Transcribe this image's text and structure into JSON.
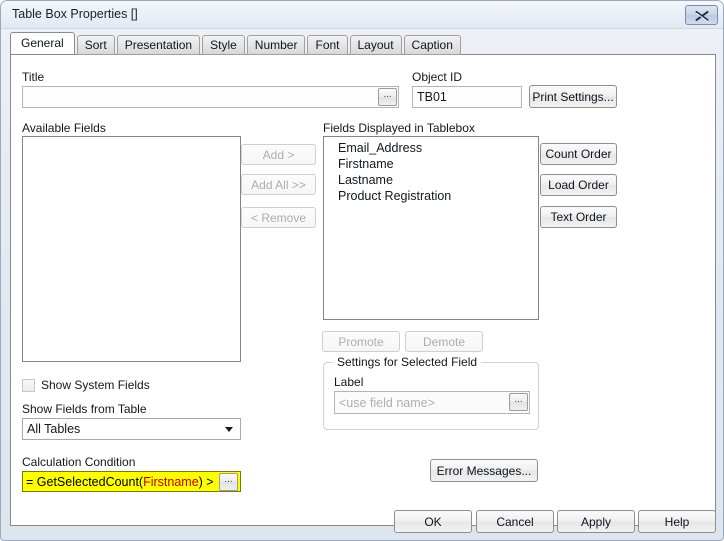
{
  "window": {
    "title": "Table Box Properties []",
    "close_icon": "close-icon"
  },
  "tabs": [
    {
      "label": "General",
      "active": true
    },
    {
      "label": "Sort",
      "active": false
    },
    {
      "label": "Presentation",
      "active": false
    },
    {
      "label": "Style",
      "active": false
    },
    {
      "label": "Number",
      "active": false
    },
    {
      "label": "Font",
      "active": false
    },
    {
      "label": "Layout",
      "active": false
    },
    {
      "label": "Caption",
      "active": false
    }
  ],
  "general": {
    "title_label": "Title",
    "title_value": "",
    "title_ellipsis": "...",
    "object_id_label": "Object ID",
    "object_id_value": "TB01",
    "print_settings_button": "Print Settings...",
    "available_fields_label": "Available Fields",
    "available_fields": [],
    "transfer_buttons": [
      {
        "label": "Add >",
        "enabled": false
      },
      {
        "label": "Add All >>",
        "enabled": false
      },
      {
        "label": "< Remove",
        "enabled": false
      }
    ],
    "displayed_fields_label": "Fields Displayed in Tablebox",
    "displayed_fields": [
      "Email_Address",
      "Firstname",
      "Lastname",
      "Product Registration"
    ],
    "order_buttons": [
      {
        "label": "Count Order",
        "enabled": true
      },
      {
        "label": "Load Order",
        "enabled": true
      },
      {
        "label": "Text Order",
        "enabled": true
      }
    ],
    "promote_button": {
      "label": "Promote",
      "enabled": false
    },
    "demote_button": {
      "label": "Demote",
      "enabled": false
    },
    "settings_group_title": "Settings for Selected Field",
    "label_field_label": "Label",
    "label_field_placeholder": "<use field name>",
    "label_field_value": "",
    "label_field_ellipsis": "...",
    "show_system_fields": {
      "label": "Show System Fields",
      "checked": false
    },
    "show_fields_from_table_label": "Show Fields from Table",
    "show_fields_from_table_value": "All Tables",
    "show_fields_from_table_options": [
      "All Tables"
    ],
    "calculation_condition_label": "Calculation Condition",
    "calculation_condition_expression_prefix": "= GetSelectedCount(",
    "calculation_condition_expression_field": "Firstname",
    "calculation_condition_expression_suffix": ") >",
    "calculation_condition_ellipsis": "...",
    "error_messages_button": "Error Messages..."
  },
  "footer": {
    "ok_button": "OK",
    "cancel_button": "Cancel",
    "apply_button": "Apply",
    "help_button": "Help"
  },
  "colors": {
    "highlight_yellow": "#ffff00",
    "field_token_red": "#c00000",
    "titlebar_text": "#16212e"
  }
}
